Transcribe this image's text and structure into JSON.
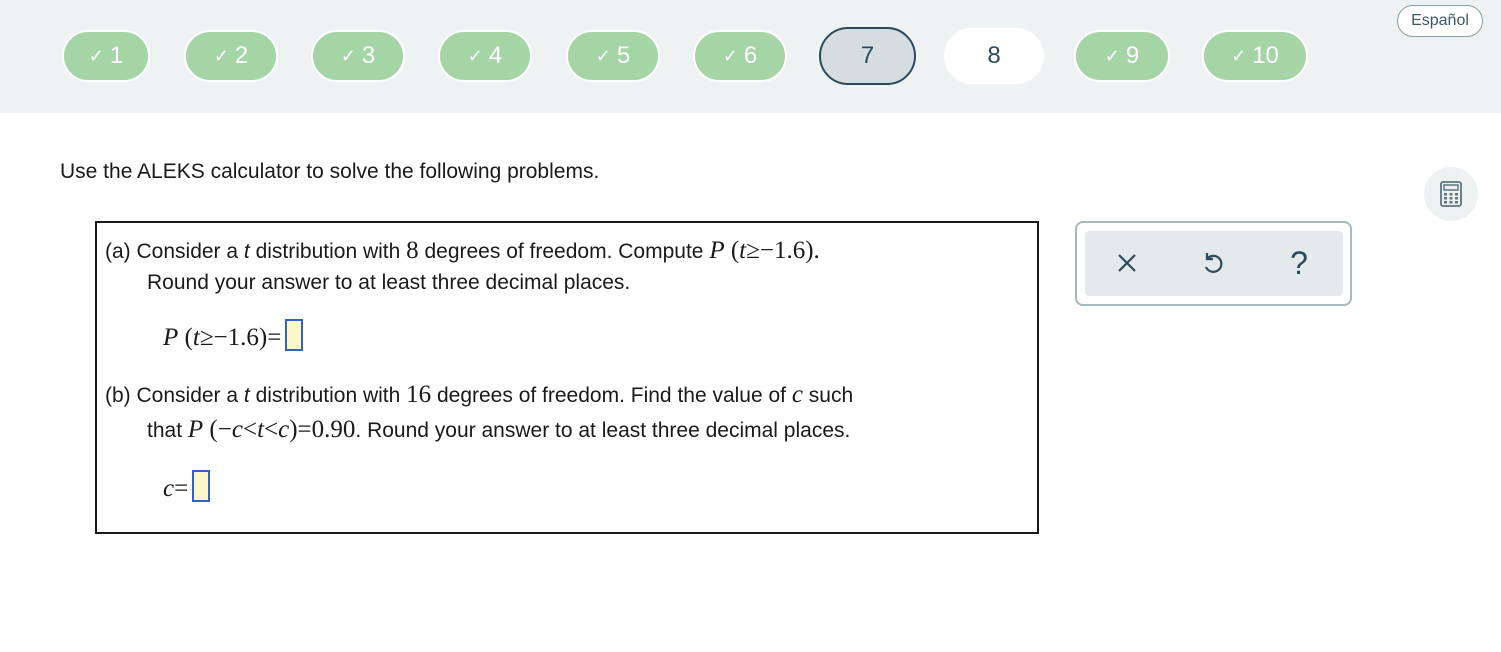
{
  "progress": {
    "questions": [
      {
        "label": "1",
        "status": "done",
        "mark": "✓"
      },
      {
        "label": "2",
        "status": "done",
        "mark": "✓"
      },
      {
        "label": "3",
        "status": "done",
        "mark": "✓"
      },
      {
        "label": "4",
        "status": "done",
        "mark": "✓"
      },
      {
        "label": "5",
        "status": "done",
        "mark": "✓"
      },
      {
        "label": "6",
        "status": "done",
        "mark": "✓"
      },
      {
        "label": "7",
        "status": "current",
        "mark": ""
      },
      {
        "label": "8",
        "status": "todo",
        "mark": ""
      },
      {
        "label": "9",
        "status": "done",
        "mark": "✓"
      },
      {
        "label": "10",
        "status": "done",
        "mark": "✓"
      }
    ]
  },
  "language_button": "Español",
  "instructions": "Use the ALEKS calculator to solve the following problems.",
  "part_a": {
    "prefix": "(a) Consider a ",
    "var_t": "t",
    "mid1": " distribution with ",
    "df": "8",
    "mid2": " degrees of freedom. Compute ",
    "expr_p": "P",
    "expr_open": " (",
    "expr_body": "≥−1.6",
    "expr_close": ").",
    "line2": "Round your answer to at least three decimal places.",
    "answer_p": "P",
    "answer_open": " (",
    "answer_body": "≥−1.6",
    "answer_close": ")="
  },
  "part_b": {
    "prefix": "(b) Consider a ",
    "var_t": "t",
    "mid1": " distribution with ",
    "df": "16",
    "mid2": " degrees of freedom. Find the value of ",
    "var_c": "c",
    "tail": " such",
    "line2_pre": "that ",
    "expr_p": "P",
    "expr_open": " (−",
    "expr_lt1": "<",
    "expr_lt2": "<",
    "expr_close": ")=0.90",
    "line2_post": ". Round your answer to at least three decimal places.",
    "answer_c": "c",
    "answer_eq": "="
  },
  "tools": {
    "clear_icon": "x-icon",
    "undo_icon": "undo-icon",
    "help_label": "?"
  },
  "calculator_icon": "calculator-icon",
  "colors": {
    "done": "#a5d4a7",
    "current_border": "#2c4a5a",
    "answer_border": "#2f63c9",
    "answer_fill": "#fdf7c9",
    "topbar": "#eff2f3"
  }
}
